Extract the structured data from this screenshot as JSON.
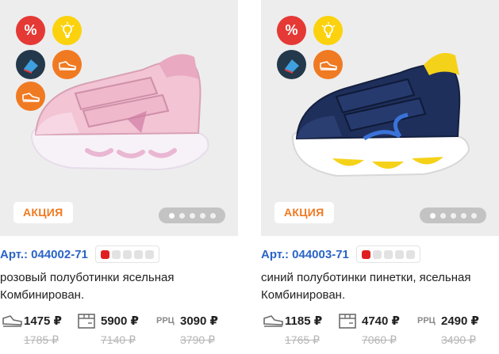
{
  "products": [
    {
      "promo_label": "АКЦИЯ",
      "article": "Арт.: 044002-71",
      "description": "розовый полуботинки ясельная Комбинирован.",
      "badges": [
        "percent-icon",
        "light-bulb-icon",
        "insole-icon",
        "sneaker-icon",
        "sneaker-icon"
      ],
      "shoe_color": "#f2c4d4",
      "sizes_total": 5,
      "sizes_available": 1,
      "gallery_dots": 5,
      "gallery_active": 1,
      "price_retail": "1475 ₽",
      "price_retail_old": "1785 ₽",
      "price_box": "5900 ₽",
      "price_box_old": "7140 ₽",
      "rrc_label": "РРЦ",
      "price_rrc": "3090 ₽",
      "price_rrc_old": "3790 ₽"
    },
    {
      "promo_label": "АКЦИЯ",
      "article": "Арт.: 044003-71",
      "description": "синий полуботинки пинетки, ясельная Комбинирован.",
      "badges": [
        "percent-icon",
        "light-bulb-icon",
        "insole-icon",
        "sneaker-icon"
      ],
      "shoe_color": "#1f2f5c",
      "sizes_total": 5,
      "sizes_available": 1,
      "gallery_dots": 5,
      "gallery_active": 1,
      "price_retail": "1185 ₽",
      "price_retail_old": "1765 ₽",
      "price_box": "4740 ₽",
      "price_box_old": "7060 ₽",
      "rrc_label": "РРЦ",
      "price_rrc": "2490 ₽",
      "price_rrc_old": "3490 ₽"
    }
  ],
  "colors": {
    "accent_blue": "#2a64c8",
    "promo_orange": "#f07a22",
    "badge_red": "#e53935",
    "badge_yellow": "#fbd20d",
    "size_on": "#e02020"
  }
}
